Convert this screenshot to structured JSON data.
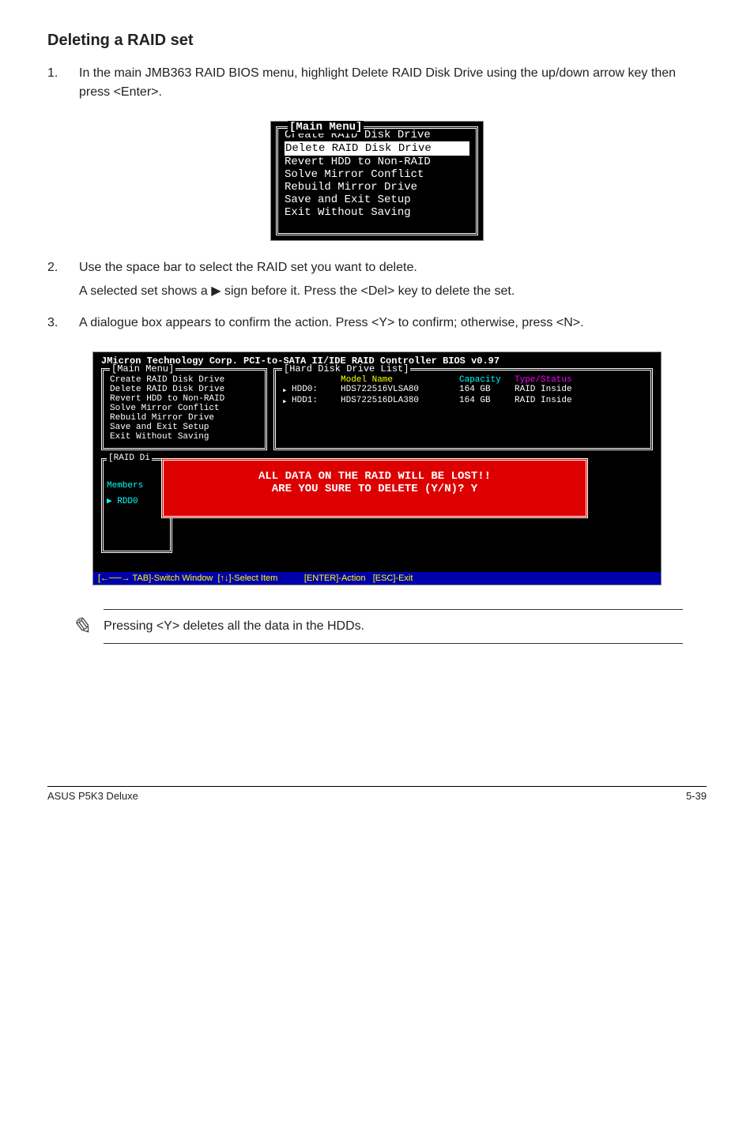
{
  "section_title": "Deleting a RAID set",
  "steps": [
    {
      "num": "1.",
      "paragraphs": [
        "In the main JMB363 RAID BIOS menu, highlight Delete RAID Disk Drive using the up/down arrow key then press <Enter>."
      ]
    },
    {
      "num": "2.",
      "paragraphs": [
        "Use the space bar to select the RAID set you want to delete.",
        "A selected set shows a ▶ sign before it. Press the <Del> key to delete the set."
      ]
    },
    {
      "num": "3.",
      "paragraphs": [
        "A dialogue box appears to confirm the action. Press <Y> to confirm; otherwise, press <N>."
      ]
    }
  ],
  "main_menu": {
    "legend": "[Main Menu]",
    "selected_index": 1,
    "items": [
      "Create RAID Disk Drive",
      "Delete RAID Disk Drive",
      "Revert HDD to Non-RAID",
      "Solve Mirror Conflict",
      "Rebuild Mirror Drive",
      "Save and Exit Setup",
      "Exit Without Saving"
    ]
  },
  "bios": {
    "title": "JMicron Technology Corp. PCI-to-SATA II/IDE RAID Controller BIOS v0.97",
    "main_legend": "[Main Menu]",
    "main_items": [
      "Create RAID Disk Drive",
      "Delete RAID Disk Drive",
      "Revert HDD to Non-RAID",
      "Solve Mirror Conflict",
      "Rebuild Mirror Drive",
      "Save and Exit Setup",
      "Exit Without Saving"
    ],
    "hdd_legend": "[Hard Disk Drive List]",
    "hdd_headers": {
      "model": "Model Name",
      "capacity": "Capacity",
      "status": "Type/Status"
    },
    "hdd_rows": [
      {
        "arrow": "▸",
        "name": "HDD0:",
        "model": "HDS722516VLSA80",
        "cap": "164 GB",
        "stat": "RAID Inside"
      },
      {
        "arrow": "▸",
        "name": "HDD1:",
        "model": "HDS722516DLA380",
        "cap": "164 GB",
        "stat": "RAID Inside"
      }
    ],
    "raid_legend": "[RAID Di",
    "raid_members": "Members",
    "raid_rdd_arrow": "▶",
    "raid_rdd": "RDD0",
    "dialog_line1": "ALL DATA ON THE RAID WILL BE LOST!!",
    "dialog_line2": "ARE YOU SURE TO DELETE (Y/N)? Y",
    "footer": "[←──→ TAB]-Switch Window  [↑↓]-Select Item           [ENTER]-Action   [ESC]-Exit"
  },
  "note_text": "Pressing <Y> deletes all the data in the HDDs.",
  "footer_left": "ASUS P5K3 Deluxe",
  "footer_right": "5-39"
}
